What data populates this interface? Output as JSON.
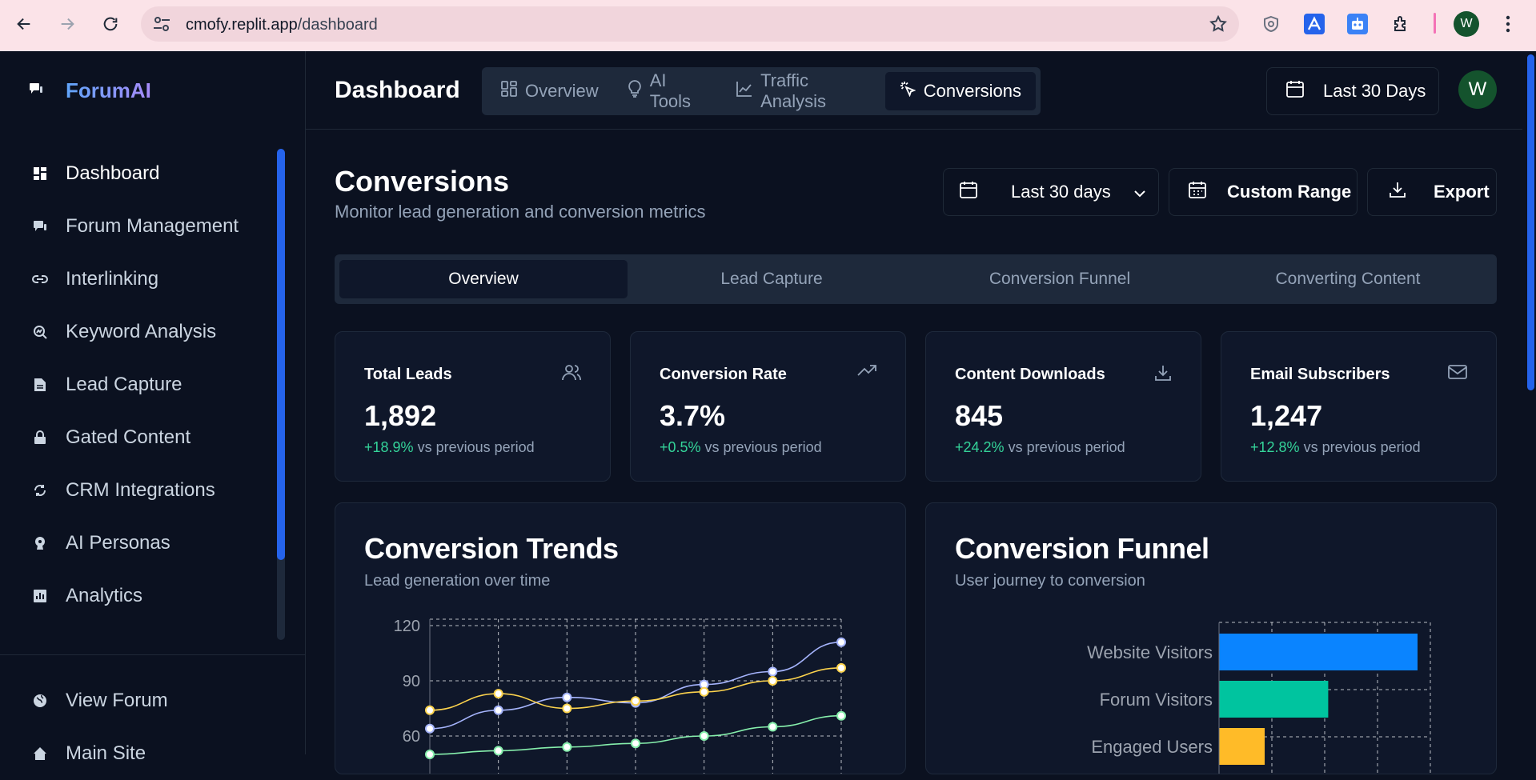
{
  "browser": {
    "url_host": "cmofy.replit.app",
    "url_path": "/dashboard",
    "profile_initial": "W"
  },
  "sidebar": {
    "brand": "ForumAI",
    "items": [
      {
        "label": "Dashboard",
        "icon": "dashboard-icon"
      },
      {
        "label": "Forum Management",
        "icon": "chat-icon"
      },
      {
        "label": "Interlinking",
        "icon": "link-icon"
      },
      {
        "label": "Keyword Analysis",
        "icon": "search-chart-icon"
      },
      {
        "label": "Lead Capture",
        "icon": "document-icon"
      },
      {
        "label": "Gated Content",
        "icon": "lock-icon"
      },
      {
        "label": "CRM Integrations",
        "icon": "sync-icon"
      },
      {
        "label": "AI Personas",
        "icon": "persona-icon"
      },
      {
        "label": "Analytics",
        "icon": "analytics-icon"
      }
    ],
    "bottom": [
      {
        "label": "View Forum",
        "icon": "globe-icon"
      },
      {
        "label": "Main Site",
        "icon": "home-icon"
      }
    ]
  },
  "topbar": {
    "title": "Dashboard",
    "tabs": [
      {
        "label": "Overview",
        "icon": "grid-icon"
      },
      {
        "label": "AI Tools",
        "icon": "lightbulb-icon"
      },
      {
        "label": "Traffic Analysis",
        "icon": "line-chart-icon"
      },
      {
        "label": "Conversions",
        "icon": "cursor-click-icon"
      }
    ],
    "range_label": "Last 30 Days",
    "avatar_initial": "W"
  },
  "section": {
    "title": "Conversions",
    "subtitle": "Monitor lead generation and conversion metrics",
    "range_select": "Last 30 days",
    "custom_range": "Custom Range",
    "export": "Export",
    "tabs": [
      "Overview",
      "Lead Capture",
      "Conversion Funnel",
      "Converting Content"
    ]
  },
  "stats": [
    {
      "label": "Total Leads",
      "value": "1,892",
      "delta": "+18.9%",
      "suffix": " vs previous period",
      "icon": "users-icon"
    },
    {
      "label": "Conversion Rate",
      "value": "3.7%",
      "delta": "+0.5%",
      "suffix": " vs previous period",
      "icon": "trending-up-icon"
    },
    {
      "label": "Content Downloads",
      "value": "845",
      "delta": "+24.2%",
      "suffix": " vs previous period",
      "icon": "download-icon"
    },
    {
      "label": "Email Subscribers",
      "value": "1,247",
      "delta": "+12.8%",
      "suffix": " vs previous period",
      "icon": "mail-icon"
    }
  ],
  "colors": {
    "series_purple": "#a5b4fc",
    "series_yellow": "#fcd34d",
    "series_green": "#86efac",
    "funnel_blue": "#0a84ff",
    "funnel_teal": "#00c49f",
    "funnel_yellow": "#ffbb28"
  },
  "trends": {
    "title": "Conversion Trends",
    "subtitle": "Lead generation over time",
    "chart_data": {
      "type": "line",
      "y_ticks": [
        "120",
        "90",
        "60"
      ],
      "ylim": [
        60,
        120
      ],
      "grid": true,
      "series": [
        {
          "values": [
            64,
            74,
            81,
            78,
            88,
            95,
            111
          ]
        },
        {
          "values": [
            74,
            83,
            75,
            79,
            84,
            90,
            97
          ]
        },
        {
          "values": [
            50,
            52,
            54,
            56,
            60,
            65,
            71
          ]
        }
      ]
    }
  },
  "funnel": {
    "title": "Conversion Funnel",
    "subtitle": "User journey to conversion",
    "chart_data": {
      "type": "bar",
      "orientation": "horizontal",
      "categories": [
        "Website Visitors",
        "Forum Visitors",
        "Engaged Users"
      ],
      "values": [
        100,
        55,
        23
      ],
      "grid": true
    }
  }
}
